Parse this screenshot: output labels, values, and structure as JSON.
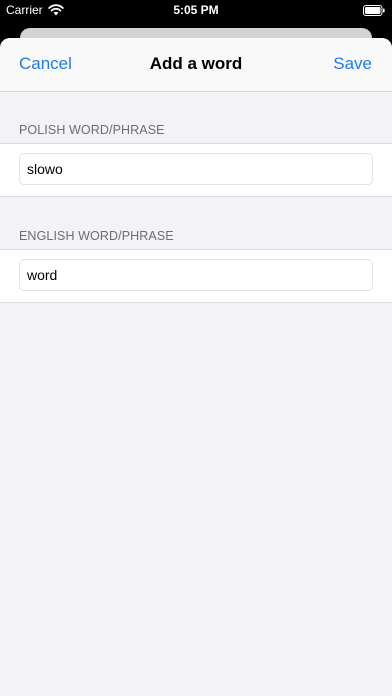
{
  "status_bar": {
    "carrier": "Carrier",
    "time": "5:05 PM"
  },
  "nav": {
    "cancel_label": "Cancel",
    "title": "Add a word",
    "save_label": "Save"
  },
  "form": {
    "polish": {
      "header": "POLISH WORD/PHRASE",
      "value": "slowo"
    },
    "english": {
      "header": "ENGLISH WORD/PHRASE",
      "value": "word"
    }
  },
  "colors": {
    "accent": "#1f7bf0",
    "background": "#f2f2f7",
    "section_header_text": "#6d6d72"
  }
}
